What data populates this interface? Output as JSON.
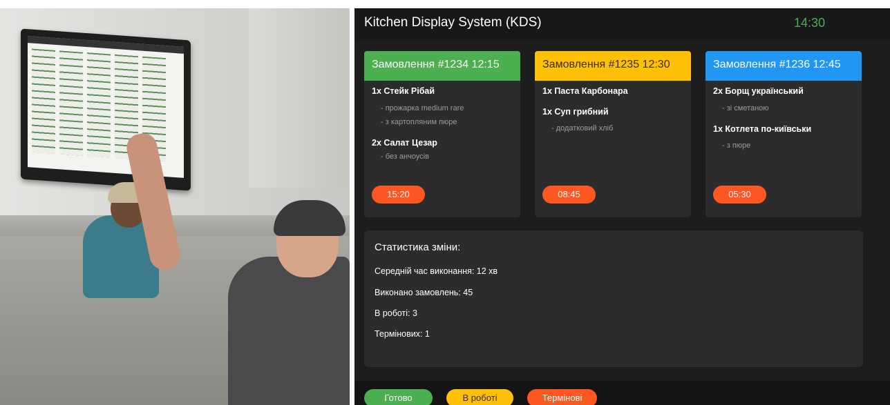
{
  "header": {
    "title": "Kitchen Display System (KDS)",
    "clock": "14:30"
  },
  "orders": [
    {
      "title": "Замовлення #1234  12:15",
      "items": [
        {
          "name": "1x Стейк Рібай",
          "mods": [
            "- прожарка medium rare",
            "- з картопляним пюре"
          ]
        },
        {
          "name": "2x Салат Цезар",
          "mods": [
            "- без анчоусів"
          ]
        }
      ],
      "timer": "15:20"
    },
    {
      "title": "Замовлення #1235  12:30",
      "items": [
        {
          "name": "1x Паста Карбонара",
          "mods": []
        },
        {
          "name": "1x Суп грибний",
          "mods": [
            "- додатковий хліб"
          ]
        }
      ],
      "timer": "08:45"
    },
    {
      "title": "Замовлення #1236  12:45",
      "items": [
        {
          "name": "2x Борщ український",
          "mods": [
            "- зі сметаною"
          ]
        },
        {
          "name": "1x Котлета по-київськи",
          "mods": [
            "- з пюре"
          ]
        }
      ],
      "timer": "05:30"
    }
  ],
  "stats": {
    "title": "Статистика зміни:",
    "avg_time": "Середній час виконання: 12 хв",
    "completed": "Виконано замовлень: 45",
    "in_progress": "В роботі: 3",
    "urgent": "Термінових: 1"
  },
  "footer": {
    "done": "Готово",
    "in_work": "В роботі",
    "urgent": "Термінові"
  },
  "colors": {
    "green": "#4caf50",
    "yellow": "#ffc107",
    "blue": "#2196f3",
    "red": "#ff5722"
  }
}
